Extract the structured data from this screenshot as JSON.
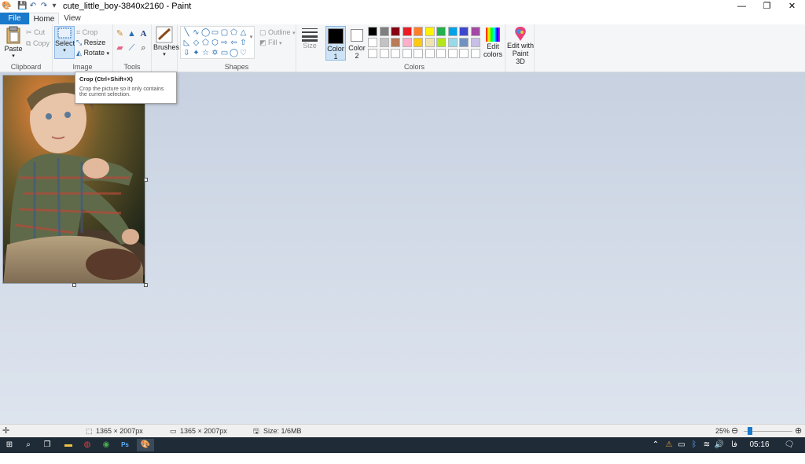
{
  "window": {
    "title": "cute_little_boy-3840x2160 - Paint"
  },
  "window_controls": {
    "minimize": "—",
    "maximize": "❐",
    "close": "✕"
  },
  "tabs": {
    "file": "File",
    "home": "Home",
    "view": "View"
  },
  "clipboard": {
    "paste": "Paste",
    "cut": "Cut",
    "copy": "Copy",
    "group_label": "Clipboard"
  },
  "image": {
    "select": "Select",
    "crop": "Crop",
    "resize": "Resize",
    "rotate": "Rotate",
    "group_label": "Image"
  },
  "tools": {
    "group_label": "Tools",
    "text_tool": "A"
  },
  "brushes": {
    "label": "Brushes"
  },
  "shapes": {
    "outline": "Outline",
    "fill": "Fill",
    "group_label": "Shapes"
  },
  "size": {
    "label": "Size"
  },
  "colors": {
    "color1_label": "Color",
    "color1_index": "1",
    "color2_label": "Color",
    "color2_index": "2",
    "edit_colors_1": "Edit",
    "edit_colors_2": "colors",
    "group_label": "Colors",
    "color1": "#000000",
    "color2": "#ffffff",
    "palette_row1": [
      "#000000",
      "#7f7f7f",
      "#880015",
      "#ed1c24",
      "#ff7f27",
      "#fff200",
      "#22b14c",
      "#00a2e8",
      "#3f48cc",
      "#a349a4"
    ],
    "palette_row2": [
      "#ffffff",
      "#c3c3c3",
      "#b97a57",
      "#ffaec9",
      "#ffc90e",
      "#efe4b0",
      "#b5e61d",
      "#99d9ea",
      "#7092be",
      "#c8bfe7"
    ],
    "palette_row3": [
      "#ffffff",
      "#ffffff",
      "#ffffff",
      "#ffffff",
      "#ffffff",
      "#ffffff",
      "#ffffff",
      "#ffffff",
      "#ffffff",
      "#ffffff"
    ]
  },
  "paint3d": {
    "line1": "Edit with",
    "line2": "Paint 3D"
  },
  "tooltip": {
    "title": "Crop (Ctrl+Shift+X)",
    "body": "Crop the picture so it only contains the current selection."
  },
  "status": {
    "selection_size": "1365 × 2007px",
    "image_size": "1365 × 2007px",
    "file_size": "Size: 1/6MB",
    "zoom": "25%",
    "zoom_fraction": 0.25
  },
  "taskbar": {
    "time": "05:16 ب.ظ",
    "lang": "فا"
  }
}
